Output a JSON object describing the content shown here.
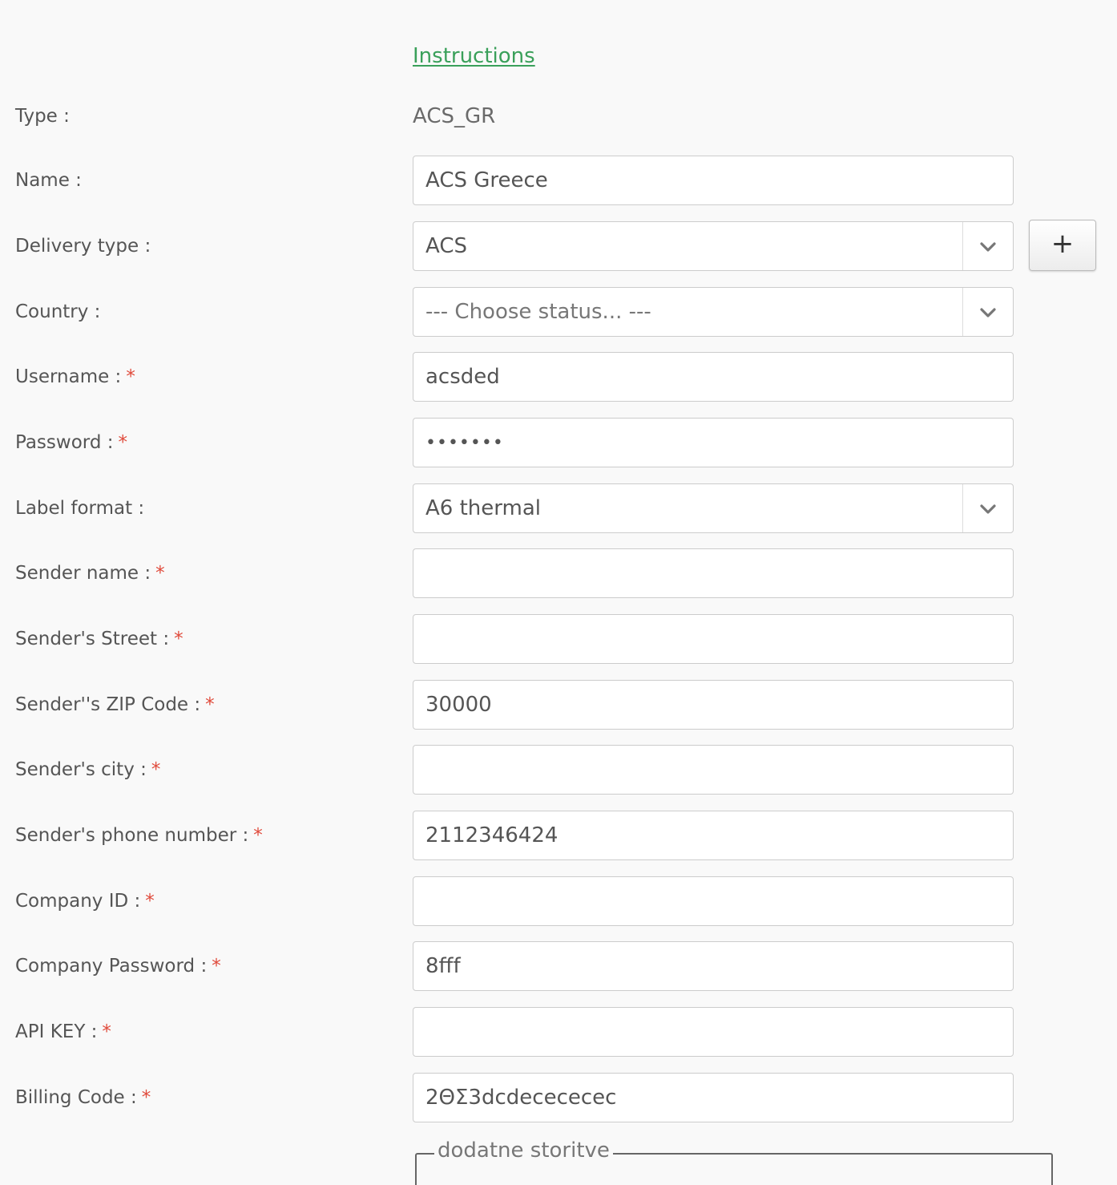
{
  "instructions_link": "Instructions",
  "colors": {
    "link": "#3aa05a",
    "required": "#e04a3b",
    "text": "#555555",
    "border": "#cccccc"
  },
  "form": {
    "type": {
      "label": "Type :",
      "value": "ACS_GR"
    },
    "name": {
      "label": "Name :",
      "value": "ACS Greece"
    },
    "delivery_type": {
      "label": "Delivery type :",
      "value": "ACS",
      "add_button": "+"
    },
    "country": {
      "label": "Country :",
      "value": "--- Choose status... ---"
    },
    "username": {
      "label": "Username :",
      "required": "*",
      "value": "acsded"
    },
    "password": {
      "label": "Password :",
      "required": "*",
      "value": "•••••••"
    },
    "label_format": {
      "label": "Label format :",
      "value": "A6 thermal"
    },
    "sender_name": {
      "label": "Sender name :",
      "required": "*",
      "value": ""
    },
    "sender_street": {
      "label": "Sender's Street :",
      "required": "*",
      "value": ""
    },
    "sender_zip": {
      "label": "Sender''s ZIP Code :",
      "required": "*",
      "value": "30000"
    },
    "sender_city": {
      "label": "Sender's city :",
      "required": "*",
      "value": ""
    },
    "sender_phone": {
      "label": "Sender's phone number :",
      "required": "*",
      "value": "2112346424"
    },
    "company_id": {
      "label": "Company ID :",
      "required": "*",
      "value": ""
    },
    "company_password": {
      "label": "Company Password :",
      "required": "*",
      "value": "8fff"
    },
    "api_key": {
      "label": "API KEY :",
      "required": "*",
      "value": ""
    },
    "billing_code": {
      "label": "Billing Code :",
      "required": "*",
      "value": "2ΘΣ3dcdecececec"
    }
  },
  "fieldset_legend": "dodatne storitve",
  "icons": {
    "dropdown": "chevron-down-icon",
    "add": "plus-icon"
  }
}
